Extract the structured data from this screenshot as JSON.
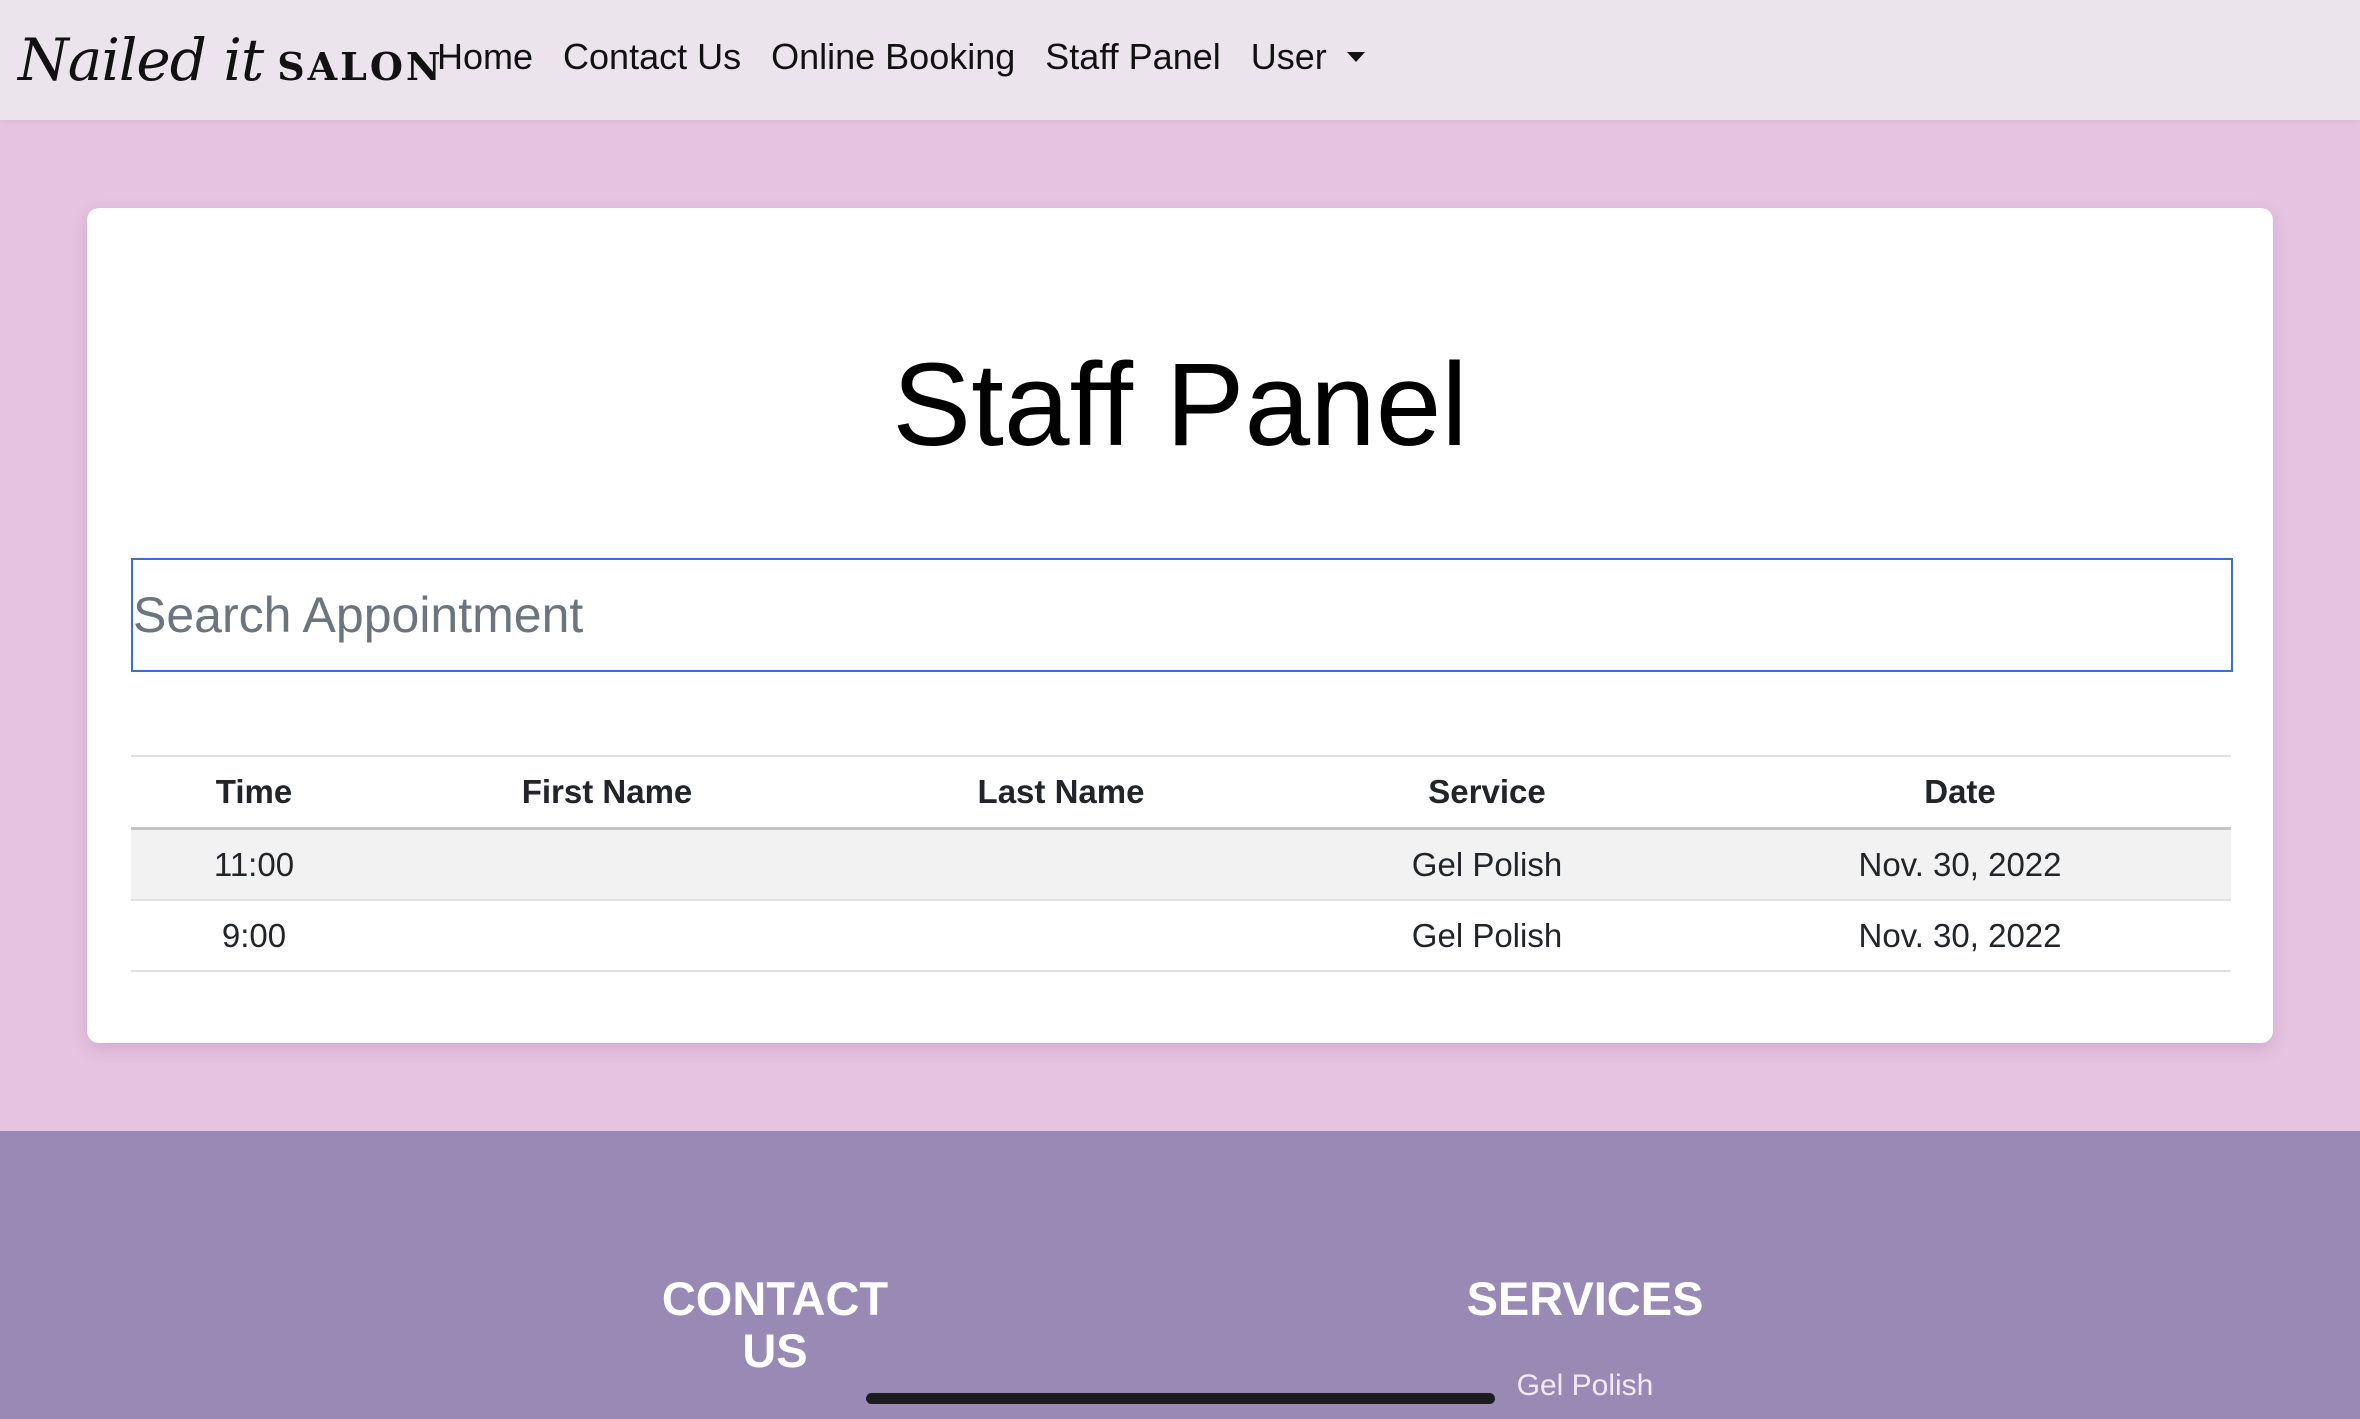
{
  "navbar": {
    "brand_script": "Nailed it",
    "brand_word": "SALON",
    "links": {
      "home": "Home",
      "contact": "Contact Us",
      "booking": "Online Booking",
      "staff": "Staff Panel",
      "user": "User"
    }
  },
  "main": {
    "title": "Staff Panel",
    "search": {
      "placeholder": "Search Appointment",
      "value": ""
    },
    "table": {
      "headers": {
        "time": "Time",
        "first_name": "First Name",
        "last_name": "Last Name",
        "service": "Service",
        "date": "Date"
      },
      "rows": [
        {
          "time": "11:00",
          "first_name": "",
          "last_name": "",
          "service": "Gel Polish",
          "date": "Nov. 30, 2022"
        },
        {
          "time": "9:00",
          "first_name": "",
          "last_name": "",
          "service": "Gel Polish",
          "date": "Nov. 30, 2022"
        }
      ]
    }
  },
  "footer": {
    "contact_heading": "CONTACT US",
    "services_heading": "SERVICES",
    "services_items": [
      "Gel Polish"
    ]
  },
  "icons": {
    "user_dropdown": "caret-down-icon"
  },
  "colors": {
    "page_background": "#e6c3e1",
    "navbar_background": "#ece4ed",
    "footer_background": "#998ab5",
    "search_border": "#3b6fd0",
    "striped_row": "#f2f2f2"
  }
}
